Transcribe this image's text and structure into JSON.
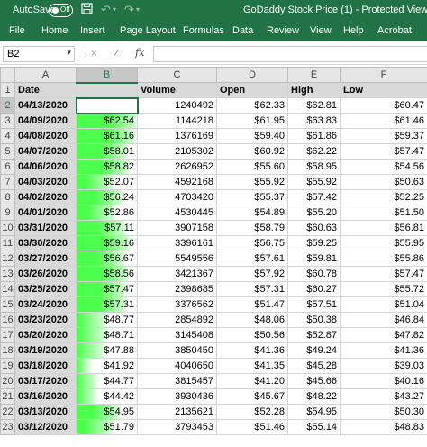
{
  "titlebar": {
    "autosave_label": "AutoSave",
    "toggle_state": "Off",
    "save_icon": "save-icon",
    "undo_icon": "undo-icon",
    "redo_icon": "redo-icon",
    "title": "GoDaddy Stock Price (1)  -  Protected View"
  },
  "ribbon": {
    "tabs": [
      "File",
      "Home",
      "Insert",
      "Page Layout",
      "Formulas",
      "Data",
      "Review",
      "View",
      "Help",
      "Acrobat"
    ]
  },
  "formula_bar": {
    "name_box": "B2",
    "cancel_icon": "×",
    "enter_icon": "✓",
    "fx_label": "fx",
    "formula_value": ""
  },
  "sheet": {
    "column_letters": [
      "A",
      "B",
      "C",
      "D",
      "E",
      "F"
    ],
    "selected_column": "B",
    "selected_row": 2,
    "active_cell": "B2",
    "headers": [
      "Date",
      "",
      "Volume",
      "Open",
      "High",
      "Low"
    ],
    "rows": [
      {
        "row": 2,
        "date": "04/13/2020",
        "b": "",
        "volume": "1240492",
        "open": "$62.33",
        "high": "$62.81",
        "low": "$60.47",
        "fill": 0
      },
      {
        "row": 3,
        "date": "04/09/2020",
        "b": "$62.54",
        "volume": "1144218",
        "open": "$61.95",
        "high": "$63.83",
        "low": "$61.46",
        "fill": 0.95
      },
      {
        "row": 4,
        "date": "04/08/2020",
        "b": "$61.16",
        "volume": "1376169",
        "open": "$59.40",
        "high": "$61.86",
        "low": "$59.37",
        "fill": 0.9
      },
      {
        "row": 5,
        "date": "04/07/2020",
        "b": "$58.01",
        "volume": "2105302",
        "open": "$60.92",
        "high": "$62.22",
        "low": "$57.47",
        "fill": 0.78
      },
      {
        "row": 6,
        "date": "04/06/2020",
        "b": "$58.82",
        "volume": "2626952",
        "open": "$55.60",
        "high": "$58.95",
        "low": "$54.56",
        "fill": 0.81
      },
      {
        "row": 7,
        "date": "04/03/2020",
        "b": "$52.07",
        "volume": "4592168",
        "open": "$55.92",
        "high": "$55.92",
        "low": "$50.63",
        "fill": 0.55
      },
      {
        "row": 8,
        "date": "04/02/2020",
        "b": "$56.24",
        "volume": "4703420",
        "open": "$55.37",
        "high": "$57.42",
        "low": "$52.25",
        "fill": 0.71
      },
      {
        "row": 9,
        "date": "04/01/2020",
        "b": "$52.86",
        "volume": "4530445",
        "open": "$54.89",
        "high": "$55.20",
        "low": "$51.50",
        "fill": 0.58
      },
      {
        "row": 10,
        "date": "03/31/2020",
        "b": "$57.11",
        "volume": "3907158",
        "open": "$58.79",
        "high": "$60.63",
        "low": "$56.81",
        "fill": 0.75
      },
      {
        "row": 11,
        "date": "03/30/2020",
        "b": "$59.16",
        "volume": "3396161",
        "open": "$56.75",
        "high": "$59.25",
        "low": "$55.95",
        "fill": 0.83
      },
      {
        "row": 12,
        "date": "03/27/2020",
        "b": "$56.67",
        "volume": "5549556",
        "open": "$57.61",
        "high": "$59.81",
        "low": "$55.86",
        "fill": 0.73
      },
      {
        "row": 13,
        "date": "03/26/2020",
        "b": "$58.56",
        "volume": "3421367",
        "open": "$57.92",
        "high": "$60.78",
        "low": "$57.47",
        "fill": 0.8
      },
      {
        "row": 14,
        "date": "03/25/2020",
        "b": "$57.47",
        "volume": "2398685",
        "open": "$57.31",
        "high": "$60.27",
        "low": "$55.72",
        "fill": 0.76
      },
      {
        "row": 15,
        "date": "03/24/2020",
        "b": "$57.31",
        "volume": "3376562",
        "open": "$51.47",
        "high": "$57.51",
        "low": "$51.04",
        "fill": 0.76
      },
      {
        "row": 16,
        "date": "03/23/2020",
        "b": "$48.77",
        "volume": "2854892",
        "open": "$48.06",
        "high": "$50.38",
        "low": "$46.84",
        "fill": 0.43
      },
      {
        "row": 17,
        "date": "03/20/2020",
        "b": "$48.71",
        "volume": "3145408",
        "open": "$50.56",
        "high": "$52.87",
        "low": "$47.82",
        "fill": 0.43
      },
      {
        "row": 18,
        "date": "03/19/2020",
        "b": "$47.88",
        "volume": "3850450",
        "open": "$41.36",
        "high": "$49.24",
        "low": "$41.36",
        "fill": 0.4
      },
      {
        "row": 19,
        "date": "03/18/2020",
        "b": "$41.92",
        "volume": "4040650",
        "open": "$41.35",
        "high": "$45.28",
        "low": "$39.03",
        "fill": 0.18
      },
      {
        "row": 20,
        "date": "03/17/2020",
        "b": "$44.77",
        "volume": "3815457",
        "open": "$41.20",
        "high": "$45.66",
        "low": "$40.16",
        "fill": 0.29
      },
      {
        "row": 21,
        "date": "03/16/2020",
        "b": "$44.42",
        "volume": "3930436",
        "open": "$45.67",
        "high": "$48.22",
        "low": "$43.27",
        "fill": 0.28
      },
      {
        "row": 22,
        "date": "03/13/2020",
        "b": "$54.95",
        "volume": "2135621",
        "open": "$52.28",
        "high": "$54.95",
        "low": "$50.30",
        "fill": 0.66
      },
      {
        "row": 23,
        "date": "03/12/2020",
        "b": "$51.79",
        "volume": "3793453",
        "open": "$51.46",
        "high": "$55.14",
        "low": "$48.83",
        "fill": 0.54
      }
    ]
  },
  "colors": {
    "excel_green": "#217346",
    "databar_strong": "#4dff4d",
    "databar_light": "#ccffcc",
    "header_fill": "#d9d9d9"
  }
}
